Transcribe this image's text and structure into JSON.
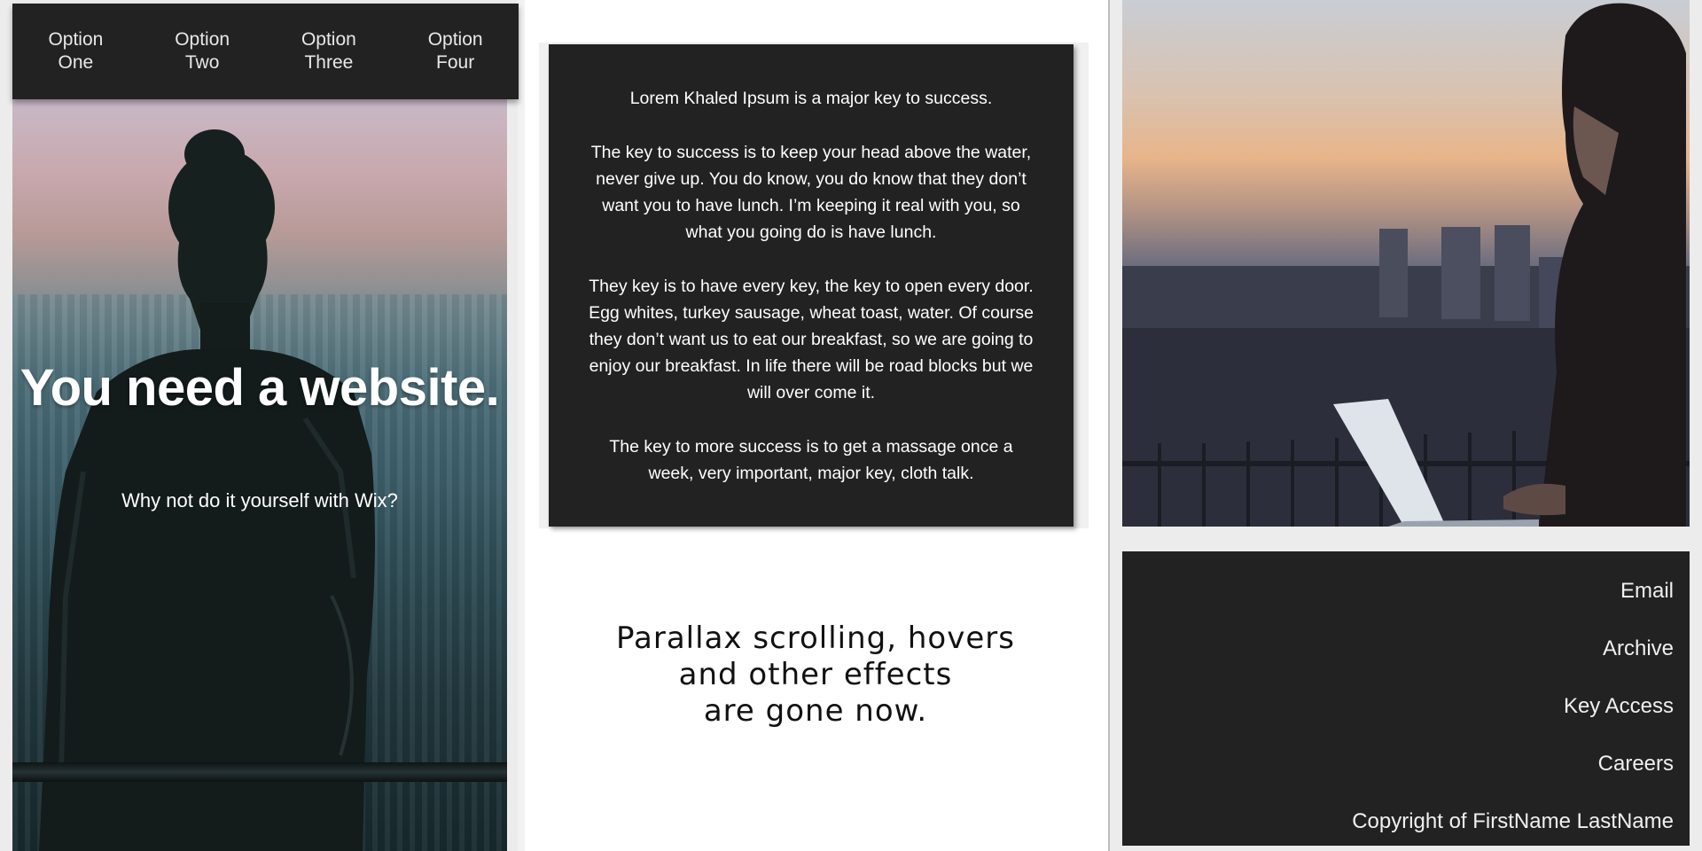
{
  "nav": {
    "items": [
      {
        "line1": "Option",
        "line2": "One"
      },
      {
        "line1": "Option",
        "line2": "Two"
      },
      {
        "line1": "Option",
        "line2": "Three"
      },
      {
        "line1": "Option",
        "line2": "Four"
      }
    ]
  },
  "hero": {
    "title": "You need a website.",
    "subtitle": "Why not do it yourself with Wix?"
  },
  "text_card": {
    "paragraphs": [
      "Lorem Khaled Ipsum is a major key to success.",
      "The key to success is to keep your head above the water, never give up. You do know, you do know that they don’t want you to have lunch. I’m keeping it real with you, so what you going do is have lunch.",
      "They key is to have every key, the key to open every door. Egg whites, turkey sausage, wheat toast, water. Of course they don’t want us to eat our breakfast, so we are going to enjoy our breakfast. In life there will be road blocks but we will over come it.",
      "The key to more success is to get a massage once a week, very important, major key, cloth talk."
    ]
  },
  "parallax_note": {
    "lines": [
      "Parallax scrolling, hovers",
      "and other effects",
      "are gone now."
    ]
  },
  "footer": {
    "links": [
      "Email",
      "Archive",
      "Key Access",
      "Careers",
      "Copyright of FirstName LastName"
    ]
  },
  "colors": {
    "dark_panel": "#222222",
    "light_text": "#ffffff",
    "page_bg": "#ffffff"
  },
  "icons": {
    "hero_image": "woman-overlooking-city-photo",
    "right_image": "man-with-laptop-at-sunset-photo"
  }
}
